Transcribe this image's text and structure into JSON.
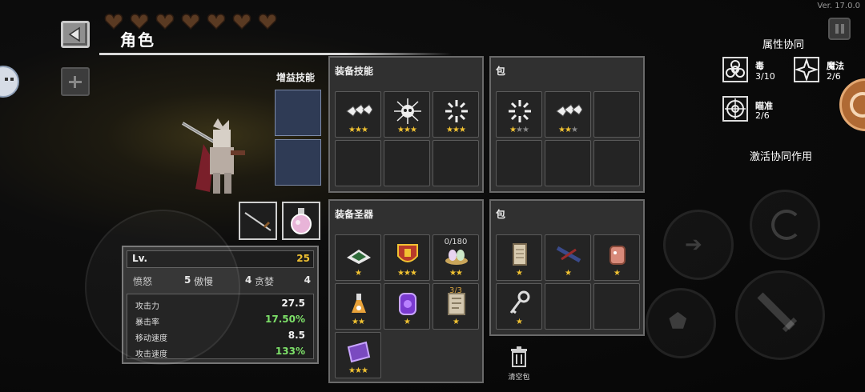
{
  "version": "Ver. 17.0.0",
  "title": "角色",
  "hearts": [
    "heart-icon",
    "heart-icon",
    "heart-icon",
    "heart-icon",
    "heart-icon",
    "heart-icon",
    "heart-icon"
  ],
  "buff_skill_label": "增益技能",
  "equip_skills": {
    "title": "装备技能",
    "slots": [
      {
        "icon": "bone-chain-icon",
        "stars": [
          "y",
          "y",
          "y"
        ]
      },
      {
        "icon": "skull-burst-icon",
        "stars": [
          "y",
          "y",
          "y"
        ]
      },
      {
        "icon": "spark-burst-icon",
        "stars": [
          "y",
          "y",
          "y"
        ]
      },
      {
        "icon": "",
        "stars": []
      },
      {
        "icon": "",
        "stars": []
      },
      {
        "icon": "",
        "stars": []
      }
    ]
  },
  "bag_skills": {
    "title": "包",
    "slots": [
      {
        "icon": "spark-burst-icon",
        "stars": [
          "y",
          "g",
          "g"
        ]
      },
      {
        "icon": "bone-chain-icon",
        "stars": [
          "y",
          "y",
          "g"
        ]
      },
      {
        "icon": "",
        "stars": []
      },
      {
        "icon": "",
        "stars": []
      },
      {
        "icon": "",
        "stars": []
      },
      {
        "icon": "",
        "stars": []
      }
    ]
  },
  "equip_relics": {
    "title": "装备圣器",
    "slots": [
      {
        "icon": "green-plate-icon",
        "stars": [
          "y"
        ],
        "count": ""
      },
      {
        "icon": "red-shield-icon",
        "stars": [
          "y",
          "y",
          "y"
        ],
        "count": ""
      },
      {
        "icon": "egg-nest-icon",
        "stars": [
          "y",
          "y"
        ],
        "count": "0/180"
      },
      {
        "icon": "potion-flask-icon",
        "stars": [
          "y",
          "y"
        ],
        "count": ""
      },
      {
        "icon": "purple-gem-icon",
        "stars": [
          "y"
        ],
        "count": ""
      },
      {
        "icon": "stone-tablet-icon",
        "stars": [
          "y"
        ],
        "count": "3/3"
      },
      {
        "icon": "purple-book-icon",
        "stars": [
          "y",
          "y",
          "y"
        ],
        "count": ""
      }
    ]
  },
  "bag_relics": {
    "title": "包",
    "slots": [
      {
        "icon": "scroll-icon",
        "stars": [
          "y"
        ]
      },
      {
        "icon": "crossbow-icon",
        "stars": [
          "y"
        ]
      },
      {
        "icon": "meat-icon",
        "stars": [
          "y"
        ]
      },
      {
        "icon": "key-icon",
        "stars": [
          "y"
        ]
      },
      {
        "icon": "",
        "stars": []
      },
      {
        "icon": "",
        "stars": []
      }
    ]
  },
  "clear_bag_label": "清空包",
  "stats": {
    "level_label": "Lv.",
    "level": "25",
    "sins": [
      {
        "label": "愤怒",
        "value": "5"
      },
      {
        "label": "傲慢",
        "value": "4"
      },
      {
        "label": "贪婪",
        "value": "4"
      }
    ],
    "rows": [
      {
        "label": "攻击力",
        "value": "27.5",
        "color": "#f2f2f2"
      },
      {
        "label": "暴击率",
        "value": "17.50%",
        "color": "#7de069"
      },
      {
        "label": "移动速度",
        "value": "8.5",
        "color": "#f2f2f2"
      },
      {
        "label": "攻击速度",
        "value": "133%",
        "color": "#7de069"
      }
    ]
  },
  "synergy": {
    "title": "属性协同",
    "items": [
      {
        "icon": "biohazard-icon",
        "name": "毒",
        "value": "3/10"
      },
      {
        "icon": "magic-star-icon",
        "name": "魔法",
        "value": "2/6"
      },
      {
        "icon": "crosshair-icon",
        "name": "瞄准",
        "value": "2/6"
      }
    ],
    "activate_label": "激活协同作用"
  },
  "colors": {
    "panel_bg": "#303030",
    "star": "#f1c232",
    "stat_green": "#7de069",
    "count_gold": "#d9a441"
  }
}
